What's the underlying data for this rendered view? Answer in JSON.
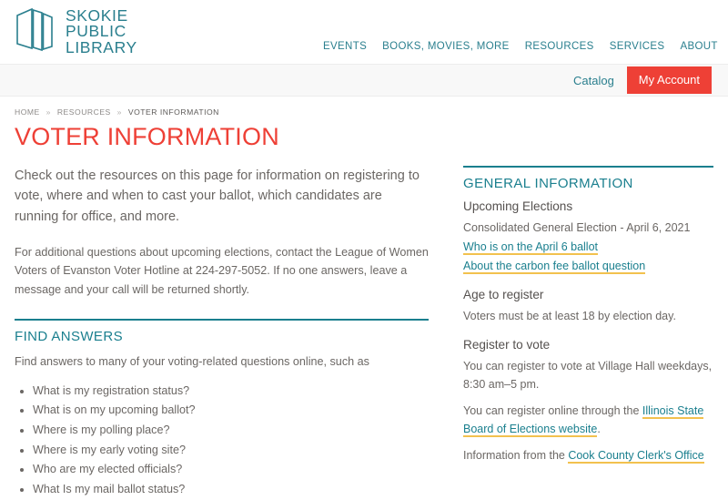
{
  "header": {
    "logo": {
      "icon": "book-pages-logo-icon",
      "text": "SKOKIE\nPUBLIC\nLIBRARY"
    },
    "nav": [
      {
        "label": "EVENTS"
      },
      {
        "label": "BOOKS, MOVIES, MORE"
      },
      {
        "label": "RESOURCES"
      },
      {
        "label": "SERVICES"
      },
      {
        "label": "ABOUT"
      }
    ],
    "search_icon": "search-icon",
    "utility": {
      "catalog_label": "Catalog",
      "account_label": "My Account"
    }
  },
  "breadcrumb": {
    "items": [
      {
        "label": "HOME"
      },
      {
        "label": "RESOURCES"
      },
      {
        "label": "VOTER INFORMATION"
      }
    ],
    "separator": "»"
  },
  "page": {
    "title": "VOTER INFORMATION",
    "lead": "Check out the resources on this page for information on registering to vote, where and when to cast your ballot, which candidates are running for office, and more.",
    "paragraph_2": "For additional questions about upcoming elections, contact the League of Women Voters of Evanston Voter Hotline at 224-297-5052. If no one answers, leave a message and your call will be returned shortly."
  },
  "find_answers": {
    "heading": "FIND ANSWERS",
    "intro": "Find answers to many of your voting-related questions online, such as",
    "items": [
      "What is my registration status?",
      "What is on my upcoming ballot?",
      "Where is my polling place?",
      "Where is my early voting site?",
      "Who are my elected officials?",
      "What Is my mail ballot status?"
    ]
  },
  "sidebar": {
    "heading": "GENERAL INFORMATION",
    "upcoming": {
      "title": "Upcoming Elections",
      "election": "Consolidated General Election - April 6, 2021",
      "link_1": "Who is on the April 6 ballot",
      "link_2": "About the carbon fee ballot question"
    },
    "age": {
      "title": "Age to register",
      "text": "Voters must be at least 18 by election day."
    },
    "register": {
      "title": "Register to vote",
      "text_1": "You can register to vote at Village Hall weekdays, 8:30 am–5 pm.",
      "text_2_before": "You can register online through the ",
      "text_2_link": "Illinois State Board of Elections website",
      "text_2_after": ".",
      "text_3_before": "Information from the ",
      "text_3_link": "Cook County Clerk's Office"
    }
  },
  "colors": {
    "teal": "#1a7f8e",
    "nav_teal": "#2a7f8e",
    "accent_red": "#ee4036",
    "link_underline": "#f2c14e",
    "body_text": "#6b6764",
    "util_bar_bg": "#f8f8f8"
  }
}
